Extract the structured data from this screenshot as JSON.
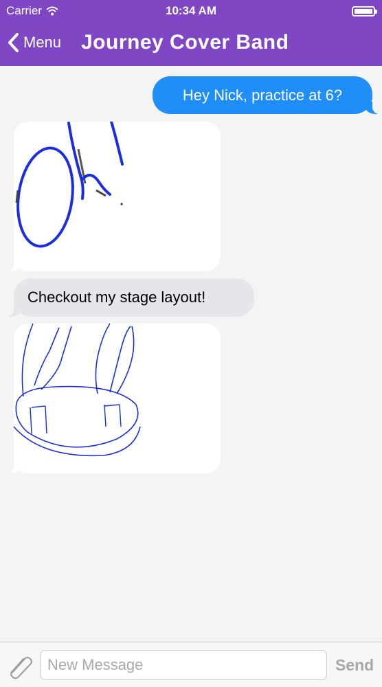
{
  "status_bar": {
    "carrier": "Carrier",
    "time": "10:34 AM",
    "icons": [
      "wifi-icon",
      "battery-icon"
    ]
  },
  "nav": {
    "back_label": "Menu",
    "back_icon": "chevron-left-icon",
    "title": "Journey Cover Band"
  },
  "messages": [
    {
      "type": "text",
      "direction": "outgoing",
      "text": "Hey Nick, practice at 6?"
    },
    {
      "type": "drawing",
      "direction": "incoming",
      "depicts": "handwritten Ok!"
    },
    {
      "type": "text",
      "direction": "incoming",
      "text": "Checkout my stage layout!"
    },
    {
      "type": "drawing",
      "direction": "incoming",
      "depicts": "stage layout sketch"
    }
  ],
  "composer": {
    "attach_icon": "paperclip-icon",
    "placeholder": "New Message",
    "value": "",
    "send_label": "Send"
  },
  "colors": {
    "nav_bar": "#7f47c4",
    "outgoing_bubble": "#1f8ef9",
    "incoming_bubble": "#e5e5ea",
    "drawing_ink": "#1a2ee0",
    "background": "#f4f4f4",
    "send_disabled": "#a7a7a7"
  }
}
